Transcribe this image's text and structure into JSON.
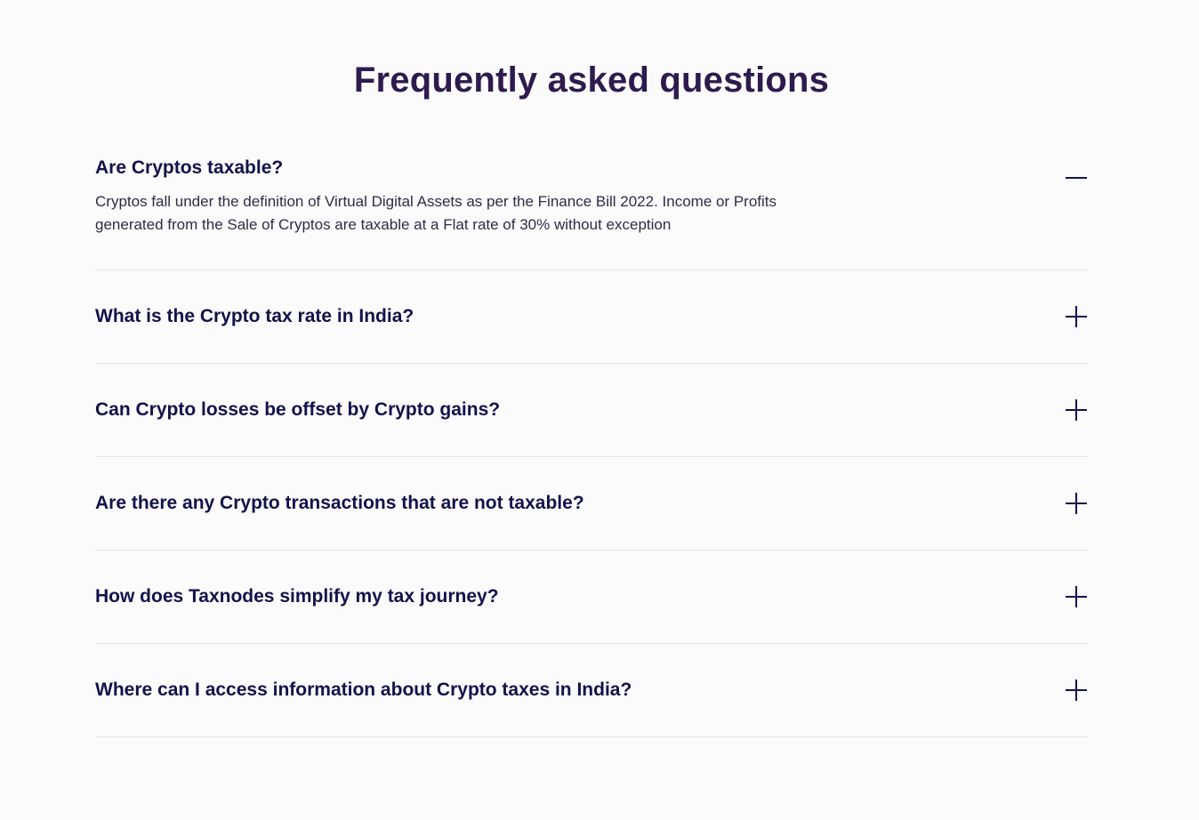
{
  "page": {
    "title": "Frequently asked questions"
  },
  "faq": {
    "items": [
      {
        "question": "Are Cryptos taxable?",
        "answer": "Cryptos fall under the definition of Virtual Digital Assets as per the Finance Bill 2022. Income or Profits generated from the Sale of Cryptos are taxable at a Flat rate of 30% without exception",
        "expanded": true,
        "icon": "minus-icon"
      },
      {
        "question": "What is the Crypto tax rate in India?",
        "expanded": false,
        "icon": "plus-icon"
      },
      {
        "question": "Can Crypto losses be offset by Crypto gains?",
        "expanded": false,
        "icon": "plus-icon"
      },
      {
        "question": "Are there any Crypto transactions that are not taxable?",
        "expanded": false,
        "icon": "plus-icon"
      },
      {
        "question": "How does Taxnodes simplify my tax journey?",
        "expanded": false,
        "icon": "plus-icon"
      },
      {
        "question": "Where can I access information about Crypto taxes in India?",
        "expanded": false,
        "icon": "plus-icon"
      }
    ]
  },
  "colors": {
    "background": "#fbfbfb",
    "title": "#2e1b4e",
    "question": "#13124a",
    "answer": "#2f2b45",
    "divider": "#e6e6ea"
  }
}
